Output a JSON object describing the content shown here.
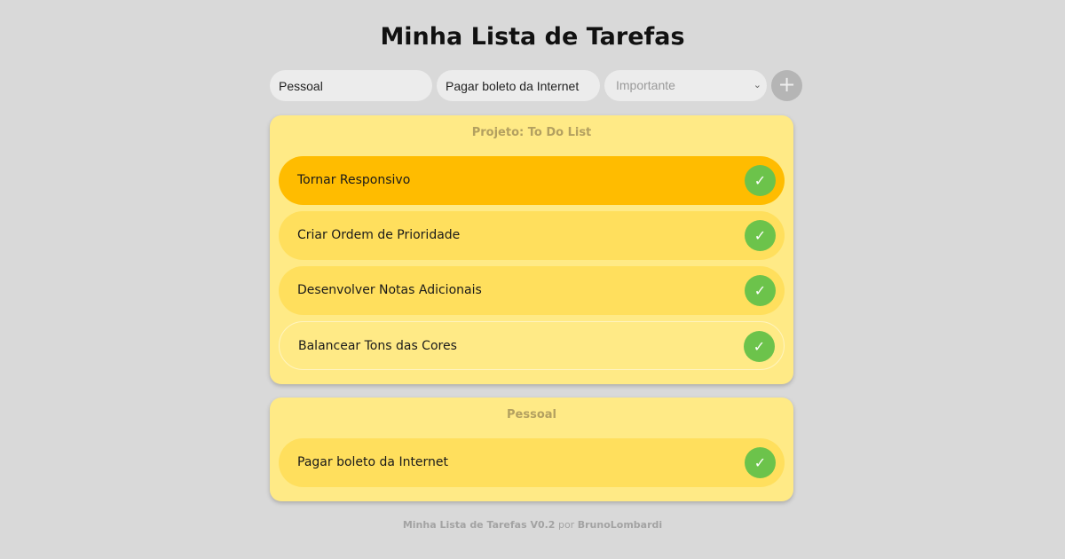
{
  "app": {
    "title": "Minha Lista de Tarefas"
  },
  "form": {
    "category_value": "Pessoal",
    "task_value": "Pagar boleto da Internet",
    "priority_placeholder": "Importante",
    "add_icon": "plus-icon"
  },
  "colors": {
    "background": "#d9d9d9",
    "card": "#ffea86",
    "priority_high": "#ffbc00",
    "priority_medium": "#ffdf5d",
    "priority_low": "#ffea86",
    "check": "#6cc34b"
  },
  "groups": [
    {
      "title": "Projeto: To Do List",
      "tasks": [
        {
          "label": "Tornar Responsivo",
          "priority": "high",
          "check_icon": "check-icon"
        },
        {
          "label": "Criar Ordem de Prioridade",
          "priority": "medium",
          "check_icon": "check-icon"
        },
        {
          "label": "Desenvolver Notas Adicionais",
          "priority": "medium",
          "check_icon": "check-icon"
        },
        {
          "label": "Balancear Tons das Cores",
          "priority": "low",
          "check_icon": "check-icon"
        }
      ]
    },
    {
      "title": "Pessoal",
      "tasks": [
        {
          "label": "Pagar boleto da Internet",
          "priority": "medium",
          "check_icon": "check-icon"
        }
      ]
    }
  ],
  "footer": {
    "app_version": "Minha Lista de Tarefas V0.2",
    "by": "por",
    "author": "BrunoLombardi"
  }
}
